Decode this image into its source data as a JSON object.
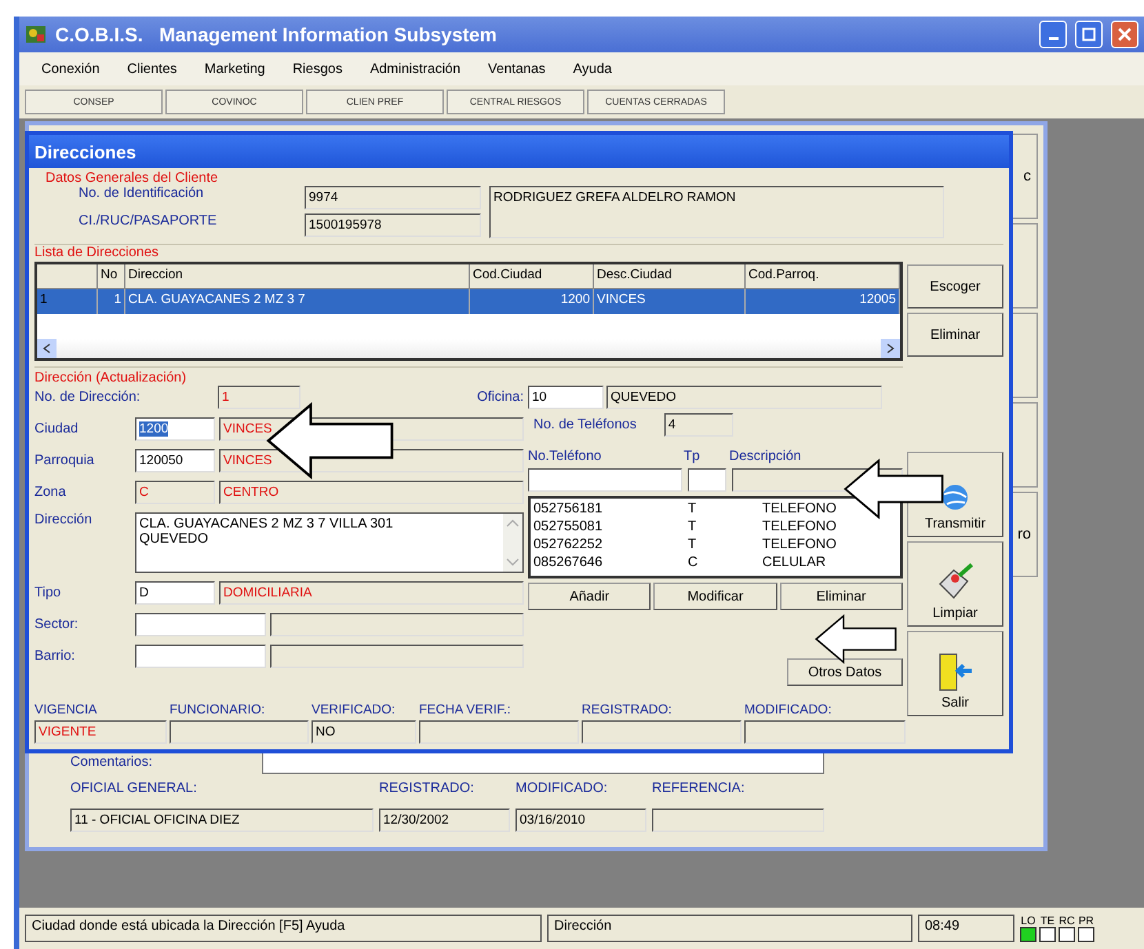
{
  "app": {
    "title": "C.O.B.I.S.   Management Information Subsystem"
  },
  "menu": [
    "Conexión",
    "Clientes",
    "Marketing",
    "Riesgos",
    "Administración",
    "Ventanas",
    "Ayuda"
  ],
  "toolbar": [
    "CONSEP",
    "COVINOC",
    "CLIEN PREF",
    "CENTRAL RIESGOS",
    "CUENTAS CERRADAS"
  ],
  "background": {
    "side_buttons": [
      "c",
      "ro"
    ],
    "comments_label": "Comentarios:",
    "fields": [
      {
        "label": "OFICIAL GENERAL:",
        "value": "11 - OFICIAL OFICINA DIEZ"
      },
      {
        "label": "REGISTRADO:",
        "value": "12/30/2002"
      },
      {
        "label": "MODIFICADO:",
        "value": "03/16/2010"
      },
      {
        "label": "REFERENCIA:"
      }
    ]
  },
  "dialog": {
    "title": "Direcciones",
    "client": {
      "section": "Datos Generales del Cliente",
      "id_label": "No. de Identificación",
      "id_value": "9974",
      "doc_label": "CI./RUC/PASAPORTE",
      "doc_value": "1500195978",
      "name": "RODRIGUEZ GREFA ALDELRO RAMON"
    },
    "list": {
      "section": "Lista de Direcciones",
      "columns": [
        "No",
        "Direccion",
        "Cod.Ciudad",
        "Desc.Ciudad",
        "Cod.Parroq."
      ],
      "rows": [
        {
          "index": "1",
          "cells": [
            "1",
            "CLA. GUAYACANES 2 MZ 3 7",
            "1200",
            "VINCES",
            "12005"
          ],
          "selected": true
        }
      ]
    },
    "list_buttons": [
      "Escoger",
      "Eliminar"
    ],
    "form": {
      "section": "Dirección (Actualización)",
      "rows": [
        {
          "kind": "number",
          "label": "No. de Dirección:",
          "value": "1"
        },
        {
          "kind": "code",
          "label": "Ciudad",
          "code": "1200",
          "editable": true,
          "selected": true,
          "desc": "VINCES"
        },
        {
          "kind": "code",
          "label": "Parroquia",
          "code": "120050",
          "editable": true,
          "selected": false,
          "desc": "VINCES"
        },
        {
          "kind": "code",
          "label": "Zona",
          "code": "C",
          "editable": false,
          "selected": false,
          "desc": "CENTRO"
        },
        {
          "kind": "text",
          "label": "Dirección",
          "value": "CLA. GUAYACANES 2 MZ 3 7 VILLA 301\nQUEVEDO"
        },
        {
          "kind": "code",
          "label": "Tipo",
          "code": "D",
          "editable": true,
          "selected": false,
          "desc": "DOMICILIARIA"
        },
        {
          "kind": "blank",
          "label": "Sector:"
        },
        {
          "kind": "blank",
          "label": "Barrio:"
        }
      ],
      "office": {
        "label": "Oficina:",
        "code": "10",
        "desc": "QUEVEDO"
      },
      "phone_count": {
        "label": "No. de Teléfonos",
        "value": "4"
      },
      "phone_columns": [
        "No.Teléfono",
        "Tp",
        "Descripción"
      ],
      "phones": [
        {
          "number": "052756181",
          "type": "T",
          "desc": "TELEFONO"
        },
        {
          "number": "052755081",
          "type": "T",
          "desc": "TELEFONO"
        },
        {
          "number": "052762252",
          "type": "T",
          "desc": "TELEFONO"
        },
        {
          "number": "085267646",
          "type": "C",
          "desc": "CELULAR"
        }
      ],
      "phone_buttons": [
        "Añadir",
        "Modificar",
        "Eliminar"
      ],
      "other_button": "Otros Datos"
    },
    "side_buttons": [
      {
        "kind": "send",
        "label": "Transmitir"
      },
      {
        "kind": "clear",
        "label": "Limpiar"
      },
      {
        "kind": "exit",
        "label": "Salir"
      }
    ],
    "footer": [
      {
        "label": "VIGENCIA",
        "value": "VIGENTE",
        "alert": true
      },
      {
        "label": "FUNCIONARIO:"
      },
      {
        "label": "VERIFICADO:",
        "value": "NO",
        "alert": false
      },
      {
        "label": "FECHA VERIF.:"
      },
      {
        "label": "REGISTRADO:"
      },
      {
        "label": "MODIFICADO:"
      }
    ]
  },
  "status_bar": {
    "hint": "Ciudad donde está ubicada la Dirección  [F5] Ayuda",
    "context": "Dirección",
    "time": "08:49",
    "indicators": [
      {
        "label": "LO",
        "on": true
      },
      {
        "label": "TE",
        "on": false
      },
      {
        "label": "RC",
        "on": false
      },
      {
        "label": "PR",
        "on": false
      }
    ]
  }
}
